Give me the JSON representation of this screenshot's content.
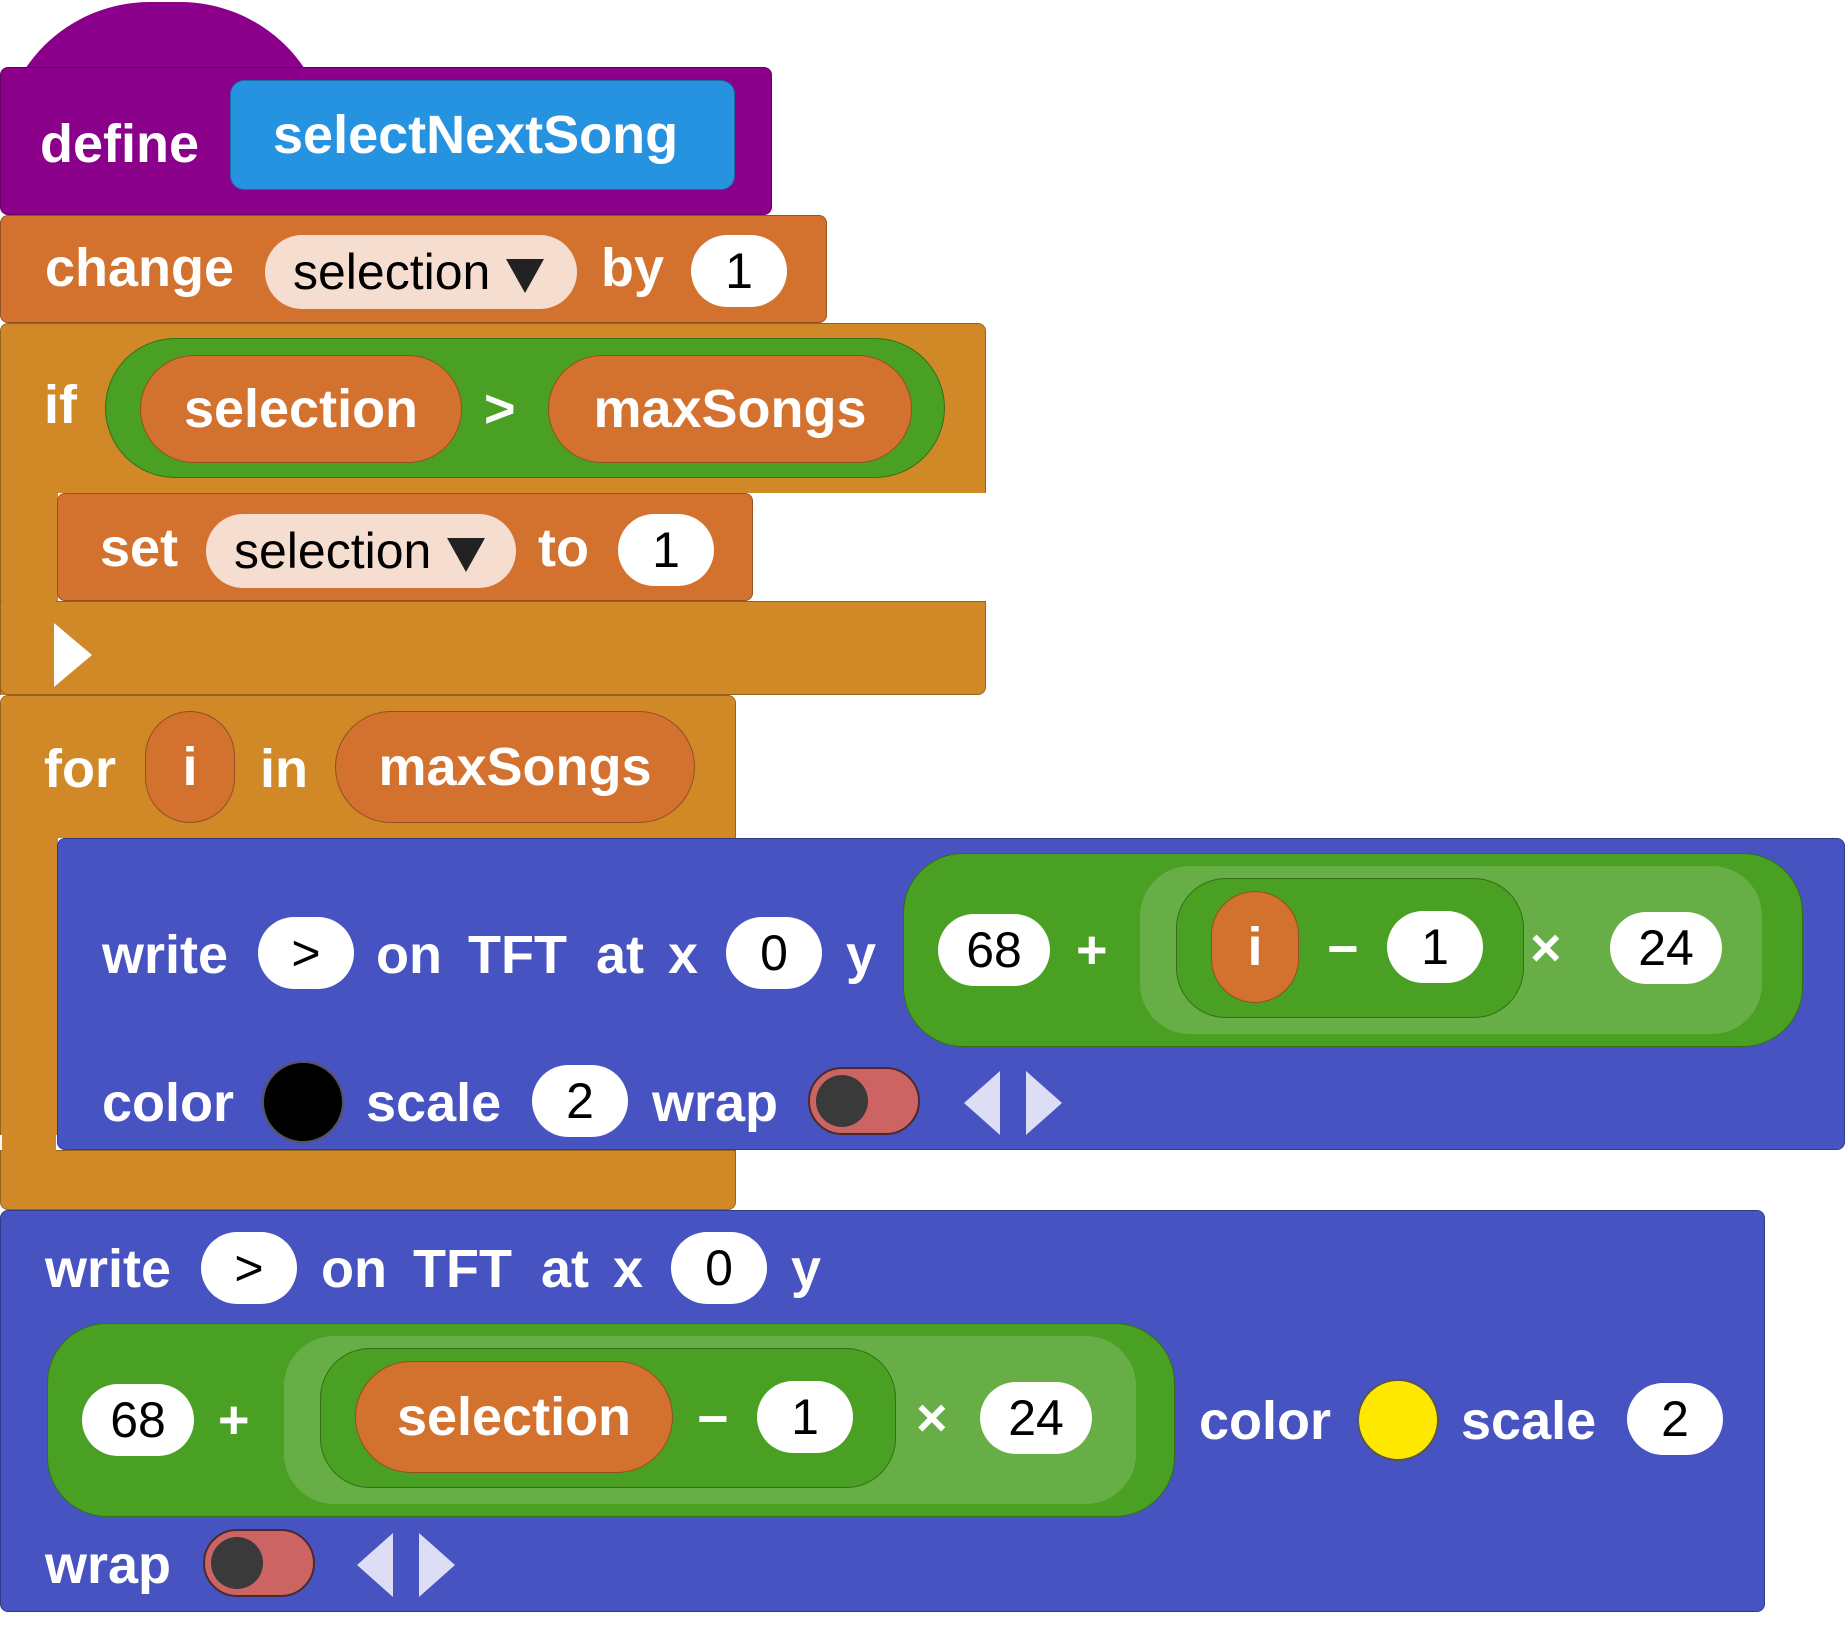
{
  "colors": {
    "define_purple": "#8B008B",
    "proc_blue": "#2693E1",
    "variable_orange": "#D3712F",
    "control_gold": "#D18928",
    "operator_green": "#49A022",
    "operator_green_light": "#66AE45",
    "tft_blue": "#4653C0",
    "dropdown_bg": "#F5DDD0",
    "toggle_red": "#CD6464",
    "swatch_black": "#000000",
    "swatch_yellow": "#FFE800"
  },
  "define_block": {
    "keyword": "define",
    "name": "selectNextSong"
  },
  "change_block": {
    "keyword": "change",
    "variable": "selection",
    "by_label": "by",
    "amount": "1"
  },
  "if_block": {
    "keyword": "if",
    "left_operand": "selection",
    "operator": ">",
    "right_operand": "maxSongs",
    "set_block": {
      "keyword": "set",
      "variable": "selection",
      "to_label": "to",
      "value": "1"
    }
  },
  "for_block": {
    "keyword": "for",
    "var": "i",
    "in_label": "in",
    "iterable": "maxSongs",
    "write_block": {
      "keyword": "write",
      "text": ">",
      "on_label": "on",
      "tft_label": "TFT",
      "at_label": "at",
      "x_label": "x",
      "x_value": "0",
      "y_label": "y",
      "expr": {
        "base": "68",
        "plus": "+",
        "var": "i",
        "minus": "−",
        "sub": "1",
        "times": "×",
        "mult": "24"
      },
      "color_label": "color",
      "scale_label": "scale",
      "scale_value": "2",
      "wrap_label": "wrap",
      "wrap_on": false,
      "color_value": "black"
    }
  },
  "write_block_2": {
    "keyword": "write",
    "text": ">",
    "on_label": "on",
    "tft_label": "TFT",
    "at_label": "at",
    "x_label": "x",
    "x_value": "0",
    "y_label": "y",
    "expr": {
      "base": "68",
      "plus": "+",
      "var": "selection",
      "minus": "−",
      "sub": "1",
      "times": "×",
      "mult": "24"
    },
    "color_label": "color",
    "scale_label": "scale",
    "scale_value": "2",
    "wrap_label": "wrap",
    "wrap_on": false,
    "color_value": "yellow"
  }
}
